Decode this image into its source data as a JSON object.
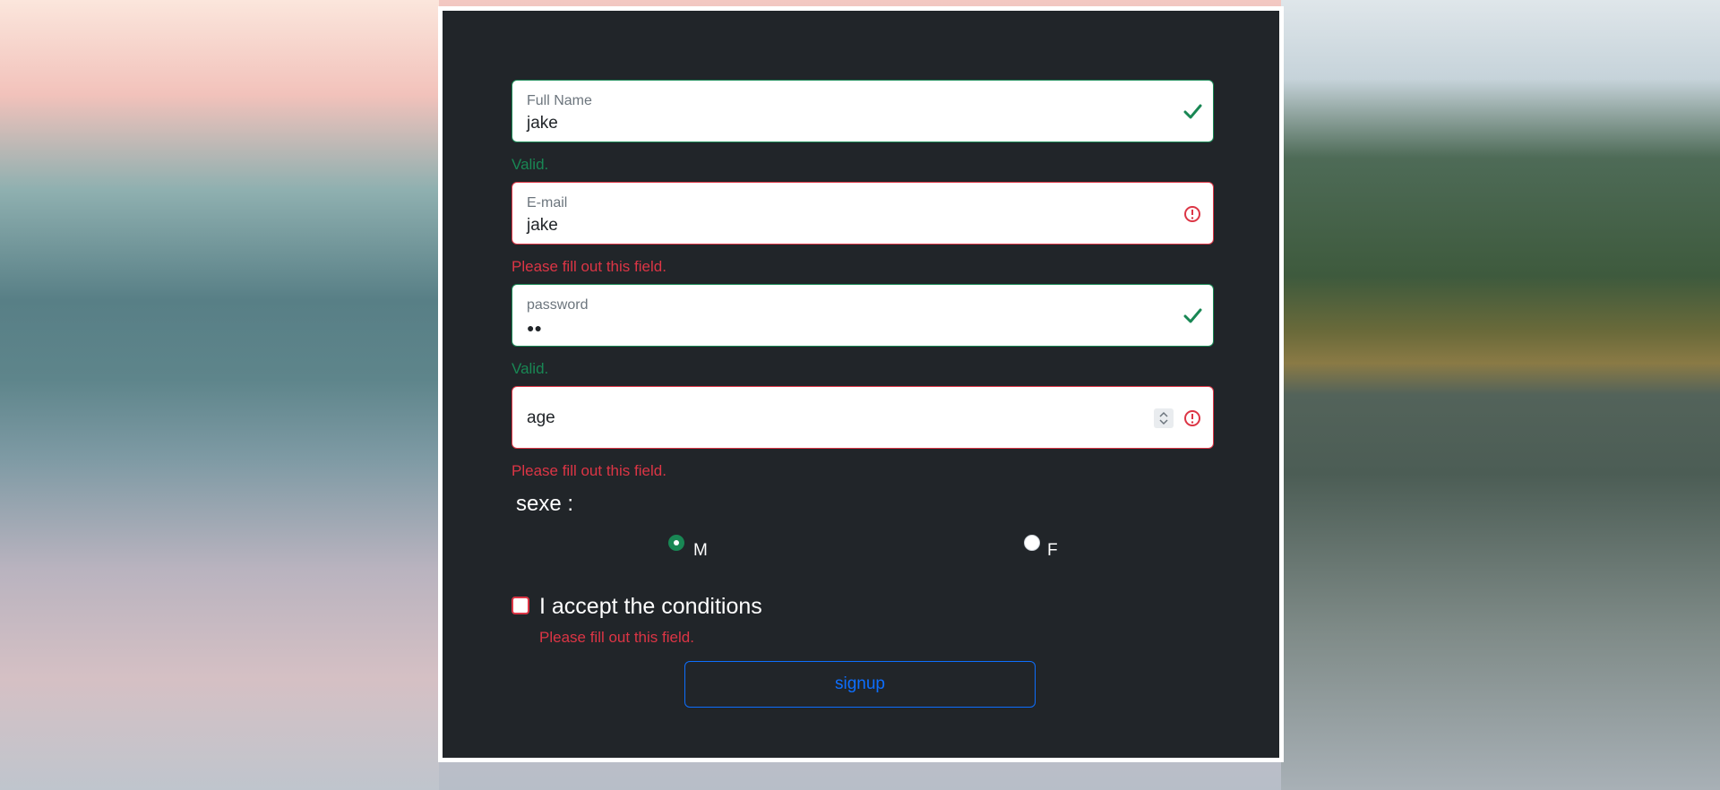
{
  "form": {
    "full_name": {
      "label": "Full Name",
      "value": "jake",
      "message": "Valid."
    },
    "email": {
      "label": "E-mail",
      "value": "jake",
      "message": "Please fill out this field."
    },
    "password": {
      "label": "password",
      "value": "●●",
      "message": "Valid."
    },
    "age": {
      "placeholder": "age",
      "message": "Please fill out this field."
    },
    "sexe": {
      "label": "sexe :",
      "options": [
        {
          "label": "M",
          "selected": true
        },
        {
          "label": "F",
          "selected": false
        }
      ]
    },
    "conditions": {
      "label": "I accept the conditions",
      "message": "Please fill out this field.",
      "checked": false
    },
    "submit_label": "signup"
  },
  "colors": {
    "valid": "#198754",
    "invalid": "#dc3545",
    "primary": "#0d6efd",
    "panel": "#212529"
  },
  "icons": {
    "valid": "check-icon",
    "invalid": "exclamation-circle-icon",
    "spinner": "number-spinner-icon"
  }
}
